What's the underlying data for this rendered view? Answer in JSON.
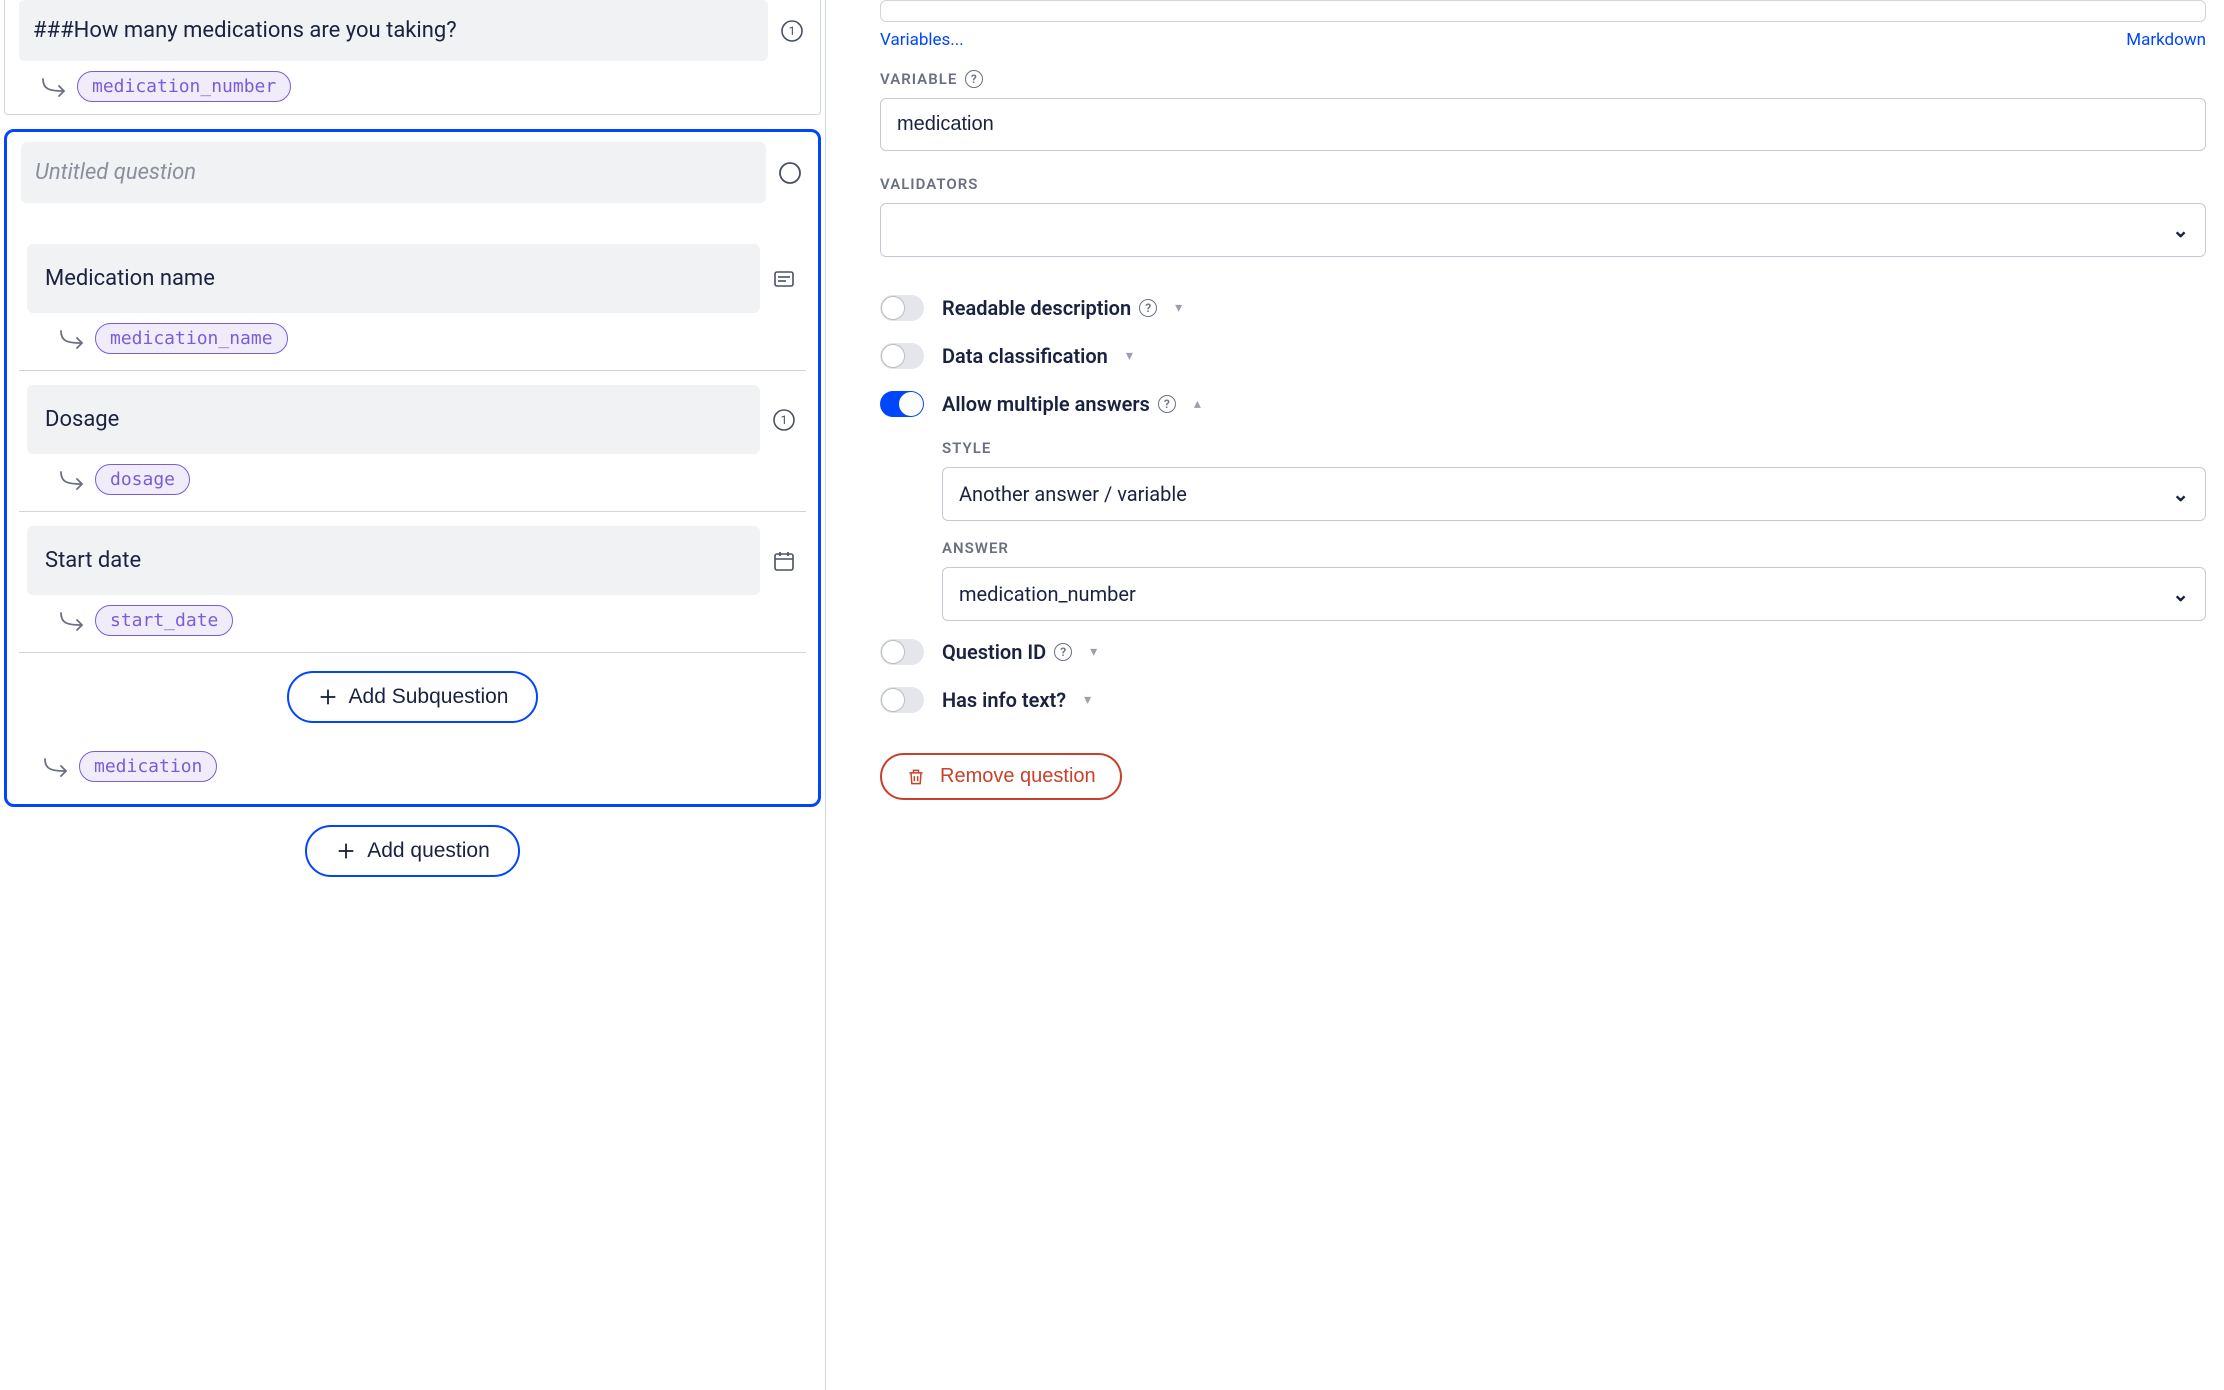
{
  "left": {
    "q1": {
      "title": "###How many medications are you taking?",
      "variable": "medication_number"
    },
    "selected": {
      "title_placeholder": "Untitled question",
      "subs": [
        {
          "title": "Medication name",
          "variable": "medication_name",
          "type": "text"
        },
        {
          "title": "Dosage",
          "variable": "dosage",
          "type": "integer"
        },
        {
          "title": "Start date",
          "variable": "start_date",
          "type": "date"
        }
      ],
      "variable": "medication",
      "add_sub_label": "Add Subquestion"
    },
    "add_question_label": "Add question"
  },
  "right": {
    "links": {
      "vars": "Variables...",
      "md": "Markdown"
    },
    "variable_label": "VARIABLE",
    "variable_value": "medication",
    "validators_label": "VALIDATORS",
    "toggles": {
      "readable": "Readable description",
      "classification": "Data classification",
      "multi": "Allow multiple answers",
      "qid": "Question ID",
      "info": "Has info text?"
    },
    "multi_section": {
      "style_label": "STYLE",
      "style_value": "Another answer / variable",
      "answer_label": "ANSWER",
      "answer_value": "medication_number"
    },
    "remove_label": "Remove question"
  }
}
